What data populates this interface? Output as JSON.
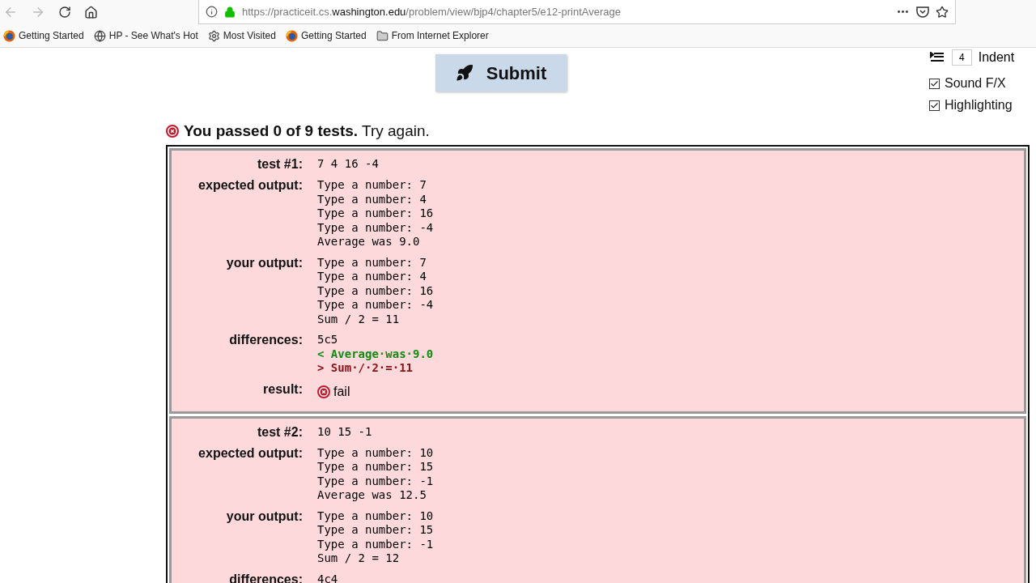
{
  "browser": {
    "url_prefix": "https://practiceit.cs.",
    "url_domain": "washington.edu",
    "url_path": "/problem/view/bjp4/chapter5/e12-printAverage",
    "bookmarks": [
      {
        "kind": "firefox",
        "label": "Getting Started"
      },
      {
        "kind": "globe",
        "label": "HP - See What's Hot"
      },
      {
        "kind": "gear",
        "label": "Most Visited"
      },
      {
        "kind": "firefox",
        "label": "Getting Started"
      },
      {
        "kind": "folder",
        "label": "From Internet Explorer"
      }
    ]
  },
  "submit": {
    "label": "Submit"
  },
  "options": {
    "indent_value": "4",
    "indent_label": "Indent",
    "checkboxes": [
      {
        "label": "Sound F/X",
        "checked": true
      },
      {
        "label": "Highlighting",
        "checked": true
      }
    ]
  },
  "summary": {
    "bold": "You passed 0 of 9 tests.",
    "rest": "Try again."
  },
  "tests": [
    {
      "label": "test #1:",
      "input": "7 4 16 -4",
      "expected_label": "expected output:",
      "expected": [
        "Type a number: 7",
        "Type a number: 4",
        "Type a number: 16",
        "Type a number: -4",
        "Average was 9.0"
      ],
      "actual_label": "your output:",
      "actual": [
        "Type a number: 7",
        "Type a number: 4",
        "Type a number: 16",
        "Type a number: -4",
        "Sum / 2 = 11"
      ],
      "diff_label": "differences:",
      "diff_header": "5c5",
      "diff_lines": [
        {
          "kind": "expected",
          "text": "< Average·was·9.0"
        },
        {
          "kind": "actual",
          "text": "> Sum·/·2·=·11"
        }
      ],
      "result_label": "result:",
      "result": "fail"
    },
    {
      "label": "test #2:",
      "input": "10 15 -1",
      "expected_label": "expected output:",
      "expected": [
        "Type a number: 10",
        "Type a number: 15",
        "Type a number: -1",
        "Average was 12.5"
      ],
      "actual_label": "your output:",
      "actual": [
        "Type a number: 10",
        "Type a number: 15",
        "Type a number: -1",
        "Sum / 2 = 12"
      ],
      "diff_label": "differences:",
      "diff_header": "4c4"
    }
  ]
}
